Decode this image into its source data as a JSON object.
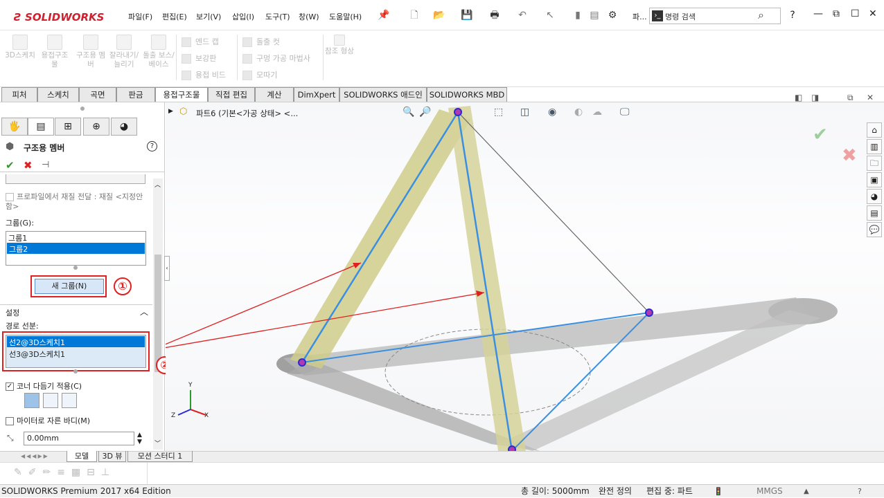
{
  "app": {
    "brand": "SOLIDWORKS"
  },
  "menu": [
    "파일(F)",
    "편집(E)",
    "보기(V)",
    "삽입(I)",
    "도구(T)",
    "창(W)",
    "도움말(H)"
  ],
  "search": {
    "placeholder": "명령 검색"
  },
  "quick_overflow": "파...",
  "ribbon": {
    "big": [
      "3D스케치",
      "용접구조물",
      "구조용 멤버",
      "잘라내기/늘리기",
      "돌출 보스/베이스",
      "참조 형상"
    ],
    "group1": [
      "엔드 캡",
      "보강판",
      "용접 비드"
    ],
    "group2": [
      "돌출 컷",
      "구멍 가공 마법사",
      "모따기"
    ]
  },
  "tabs": [
    "피처",
    "스케치",
    "곡면",
    "판금",
    "용접구조물",
    "직접 편집",
    "계산",
    "DimXpert",
    "SOLIDWORKS 애드인",
    "SOLIDWORKS MBD"
  ],
  "active_tab": "용접구조물",
  "panel": {
    "title": "구조용 멤버",
    "transfer_material": "프로파일에서 재질 전달 : 재질 <지정안함>",
    "group_label": "그룹(G):",
    "groups": [
      "그룹1",
      "그룹2"
    ],
    "new_group_button": "새 그룹(N)",
    "settings_header": "설정",
    "path_label": "경로 선분:",
    "paths": [
      "선2@3D스케치1",
      "선3@3D스케치1"
    ],
    "corner_treatment": "코너 다듬기 적용(C)",
    "miter_label": "마이터로 자른 바디(M)",
    "gap_value": "0.00mm"
  },
  "annotations": {
    "one": "①",
    "two": "②"
  },
  "viewport": {
    "tree_item": "파트6  (기본<가공 상태> <...",
    "triad": {
      "y": "Y",
      "z": "Z",
      "x": "X"
    }
  },
  "bottom_tabs": [
    "모델",
    "3D 뷰",
    "모션 스터디 1"
  ],
  "status": {
    "edition": "SOLIDWORKS Premium 2017 x64 Edition",
    "total_length": "총 길이: 5000mm",
    "defined": "완전 정의",
    "editing": "편집 중: 파트",
    "units": "MMGS"
  },
  "colors": {
    "accent_red": "#e02020",
    "selection_blue": "#0078d7",
    "sketch_line": "#3a8fe0",
    "member_yellow": "#d6d29a",
    "member_grey": "#b5b5b5"
  }
}
